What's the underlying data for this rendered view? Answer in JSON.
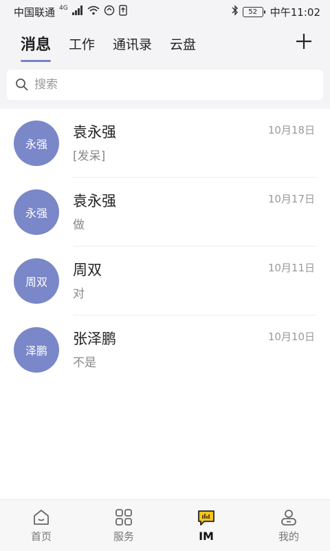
{
  "status_bar": {
    "carrier": "中国联通",
    "network": "4G",
    "battery": "52",
    "time": "中午11:02"
  },
  "tabs": [
    {
      "label": "消息",
      "active": true
    },
    {
      "label": "工作",
      "active": false
    },
    {
      "label": "通讯录",
      "active": false
    },
    {
      "label": "云盘",
      "active": false
    }
  ],
  "add_icon": "plus-icon",
  "search": {
    "placeholder": "搜索",
    "value": ""
  },
  "conversations": [
    {
      "avatar_text": "永强",
      "name": "袁永强",
      "preview": "[发呆]",
      "date": "10月18日"
    },
    {
      "avatar_text": "永强",
      "name": "袁永强",
      "preview": "做",
      "date": "10月17日"
    },
    {
      "avatar_text": "周双",
      "name": "周双",
      "preview": "对",
      "date": "10月11日"
    },
    {
      "avatar_text": "泽鹏",
      "name": "张泽鹏",
      "preview": "不是",
      "date": "10月10日"
    }
  ],
  "bottom_nav": [
    {
      "label": "首页",
      "icon": "home-icon",
      "active": false
    },
    {
      "label": "服务",
      "icon": "grid-icon",
      "active": false
    },
    {
      "label": "IM",
      "icon": "chat-icon",
      "active": true
    },
    {
      "label": "我的",
      "icon": "profile-icon",
      "active": false
    }
  ],
  "colors": {
    "accent": "#7481c6",
    "avatar_bg": "#7a87c8",
    "im_icon_yellow": "#f5c518"
  }
}
